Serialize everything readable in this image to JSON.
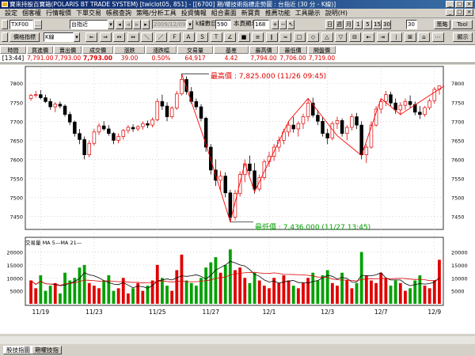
{
  "window": {
    "title": "寶來持股百寶箱(POLARIS BT TRADE SYSTEM) [twiclot05, 851] - [[6700] 期/權技術指標走勢圖 : 台指近 (30 分 - K線)]"
  },
  "menu": [
    "設定",
    "個客權",
    "行情報價",
    "下單交易",
    "帳務查詢",
    "策略/分析工具",
    "投資情報",
    "組合畫面",
    "新寶貴",
    "推薦功能",
    "工具顯示",
    "說明(H)"
  ],
  "toolbar": {
    "symbol_code": "TXF00",
    "symbol_name": "台指近",
    "date": "2009/12/09",
    "kbar_count_label": "k線數目",
    "kbar_count": "590",
    "ref_days_label": "本頁顯示",
    "ref_days": "168",
    "period_buttons": [
      "日",
      "週",
      "月",
      "1",
      "5",
      "15",
      "30"
    ],
    "period_value": "30",
    "strategy_button": "策略",
    "tool_button": "Tool",
    "display_button": "顯示",
    "indicator_button": "價格指標",
    "chart_type": "K線"
  },
  "quote": {
    "headers": [
      "時間",
      "買進價",
      "賣出價",
      "成交價",
      "漲跌",
      "漲跌幅",
      "交易量",
      "基差",
      "最高價",
      "最低價",
      "開盤價"
    ],
    "values": [
      "[13:44]",
      "7,791.00",
      "7,793.00",
      "7,793.00",
      "39.00",
      "0.50%",
      "64,917",
      "4.42",
      "7,794.00",
      "7,706.00",
      "7,719.00"
    ]
  },
  "chart": {
    "high_annotation": "最高價 : 7,825.000 (11/26 09:45)",
    "low_annotation": "最低價 : 7,436.000 (11/27 13:45)",
    "volume_legend": "交易量 MA  5—MA 21—",
    "price_ticks_right": [
      "7800",
      "7750",
      "7700",
      "7650",
      "7600",
      "7550",
      "7500",
      "7450"
    ],
    "price_ticks_left": [
      "7800",
      "7750",
      "7700",
      "7650",
      "7600",
      "7550",
      "7500",
      "7450"
    ],
    "volume_ticks": [
      "20000",
      "15000",
      "10000",
      "5000"
    ],
    "date_ticks": [
      "11/19",
      "11/23",
      "11/25",
      "11/27",
      "12/1",
      "12/3",
      "12/7",
      "12/9"
    ],
    "colors": {
      "up": "#e00000",
      "down": "#000000",
      "pattern": "#ff0000",
      "vol_up": "#e00000",
      "vol_down": "#00a000",
      "ma5": "#000000",
      "ma21": "#e00000"
    }
  },
  "tabs": [
    "股技指圖",
    "期權技指"
  ],
  "chart_data": {
    "type": "candlestick",
    "price_range": [
      7420,
      7840
    ],
    "volume_range": [
      0,
      22000
    ],
    "high": {
      "value": 7825,
      "time": "11/26 09:45"
    },
    "low": {
      "value": 7436,
      "time": "11/27 13:45"
    },
    "candles": [
      [
        7760,
        7772,
        7754,
        7768
      ],
      [
        7768,
        7780,
        7762,
        7770
      ],
      [
        7770,
        7782,
        7758,
        7762
      ],
      [
        7762,
        7770,
        7748,
        7752
      ],
      [
        7752,
        7760,
        7730,
        7738
      ],
      [
        7738,
        7750,
        7724,
        7745
      ],
      [
        7745,
        7752,
        7734,
        7740
      ],
      [
        7740,
        7745,
        7712,
        7718
      ],
      [
        7718,
        7725,
        7690,
        7698
      ],
      [
        7698,
        7702,
        7660,
        7668
      ],
      [
        7668,
        7680,
        7640,
        7652
      ],
      [
        7652,
        7660,
        7600,
        7612
      ],
      [
        7612,
        7650,
        7605,
        7642
      ],
      [
        7642,
        7680,
        7636,
        7672
      ],
      [
        7672,
        7695,
        7664,
        7688
      ],
      [
        7688,
        7700,
        7675,
        7680
      ],
      [
        7680,
        7690,
        7662,
        7668
      ],
      [
        7668,
        7672,
        7640,
        7650
      ],
      [
        7650,
        7668,
        7642,
        7660
      ],
      [
        7660,
        7680,
        7652,
        7676
      ],
      [
        7676,
        7690,
        7668,
        7684
      ],
      [
        7684,
        7692,
        7672,
        7680
      ],
      [
        7680,
        7690,
        7674,
        7686
      ],
      [
        7686,
        7700,
        7678,
        7694
      ],
      [
        7694,
        7702,
        7682,
        7690
      ],
      [
        7690,
        7710,
        7684,
        7704
      ],
      [
        7704,
        7760,
        7700,
        7752
      ],
      [
        7752,
        7770,
        7730,
        7740
      ],
      [
        7740,
        7750,
        7700,
        7712
      ],
      [
        7712,
        7740,
        7706,
        7735
      ],
      [
        7735,
        7780,
        7730,
        7772
      ],
      [
        7772,
        7825,
        7768,
        7810
      ],
      [
        7810,
        7818,
        7770,
        7778
      ],
      [
        7778,
        7790,
        7746,
        7752
      ],
      [
        7752,
        7760,
        7730,
        7738
      ],
      [
        7738,
        7745,
        7700,
        7708
      ],
      [
        7708,
        7712,
        7620,
        7632
      ],
      [
        7632,
        7640,
        7560,
        7572
      ],
      [
        7572,
        7600,
        7530,
        7545
      ],
      [
        7545,
        7570,
        7520,
        7556
      ],
      [
        7556,
        7566,
        7500,
        7512
      ],
      [
        7512,
        7520,
        7436,
        7448
      ],
      [
        7448,
        7520,
        7440,
        7510
      ],
      [
        7510,
        7568,
        7502,
        7560
      ],
      [
        7560,
        7600,
        7540,
        7588
      ],
      [
        7588,
        7610,
        7560,
        7570
      ],
      [
        7570,
        7590,
        7510,
        7522
      ],
      [
        7522,
        7560,
        7516,
        7552
      ],
      [
        7552,
        7600,
        7546,
        7594
      ],
      [
        7594,
        7620,
        7580,
        7608
      ],
      [
        7608,
        7640,
        7596,
        7632
      ],
      [
        7632,
        7660,
        7620,
        7650
      ],
      [
        7650,
        7680,
        7640,
        7672
      ],
      [
        7672,
        7700,
        7660,
        7690
      ],
      [
        7690,
        7712,
        7670,
        7680
      ],
      [
        7680,
        7700,
        7660,
        7694
      ],
      [
        7694,
        7720,
        7680,
        7712
      ],
      [
        7712,
        7760,
        7700,
        7748
      ],
      [
        7748,
        7762,
        7710,
        7716
      ],
      [
        7716,
        7730,
        7690,
        7700
      ],
      [
        7700,
        7712,
        7660,
        7668
      ],
      [
        7668,
        7680,
        7640,
        7656
      ],
      [
        7656,
        7700,
        7650,
        7694
      ],
      [
        7694,
        7712,
        7680,
        7702
      ],
      [
        7702,
        7708,
        7660,
        7668
      ],
      [
        7668,
        7690,
        7650,
        7684
      ],
      [
        7684,
        7720,
        7676,
        7712
      ],
      [
        7712,
        7722,
        7680,
        7690
      ],
      [
        7690,
        7700,
        7600,
        7612
      ],
      [
        7612,
        7640,
        7590,
        7632
      ],
      [
        7632,
        7700,
        7628,
        7690
      ],
      [
        7690,
        7740,
        7686,
        7732
      ],
      [
        7732,
        7760,
        7720,
        7752
      ],
      [
        7752,
        7780,
        7740,
        7770
      ],
      [
        7770,
        7778,
        7740,
        7748
      ],
      [
        7748,
        7760,
        7720,
        7730
      ],
      [
        7730,
        7750,
        7716,
        7742
      ],
      [
        7742,
        7760,
        7730,
        7752
      ],
      [
        7752,
        7768,
        7736,
        7744
      ],
      [
        7744,
        7752,
        7716,
        7724
      ],
      [
        7724,
        7740,
        7706,
        7718
      ],
      [
        7718,
        7740,
        7712,
        7736
      ],
      [
        7736,
        7760,
        7730,
        7754
      ],
      [
        7754,
        7790,
        7746,
        7784
      ],
      [
        7784,
        7794,
        7770,
        7793
      ]
    ],
    "volumes": [
      9000,
      6000,
      11000,
      5000,
      7000,
      8000,
      4000,
      12000,
      9000,
      10000,
      14000,
      15000,
      8000,
      7000,
      6000,
      9000,
      11000,
      5000,
      6000,
      10000,
      4000,
      6000,
      8000,
      5000,
      7000,
      9000,
      15000,
      10000,
      7000,
      5000,
      13000,
      19000,
      9000,
      8000,
      7000,
      10000,
      14000,
      16000,
      18000,
      12000,
      15000,
      21000,
      13000,
      14000,
      10000,
      8000,
      12000,
      9000,
      7000,
      6000,
      10000,
      8000,
      11000,
      9000,
      7000,
      6000,
      8000,
      10000,
      12000,
      9000,
      11000,
      13000,
      8000,
      7000,
      12000,
      9000,
      6000,
      8000,
      20000,
      11000,
      9000,
      8000,
      12000,
      10000,
      7000,
      9000,
      8000,
      5000,
      6000,
      9000,
      11000,
      7000,
      6000,
      9000,
      17000
    ],
    "pattern_points": [
      [
        31,
        7825
      ],
      [
        36,
        7640
      ],
      [
        41,
        7436
      ],
      [
        44,
        7590
      ],
      [
        46,
        7515
      ],
      [
        53,
        7700
      ],
      [
        57,
        7760
      ],
      [
        63,
        7662
      ],
      [
        68,
        7610
      ],
      [
        72,
        7760
      ],
      [
        76,
        7718
      ],
      [
        85,
        7793
      ]
    ]
  }
}
